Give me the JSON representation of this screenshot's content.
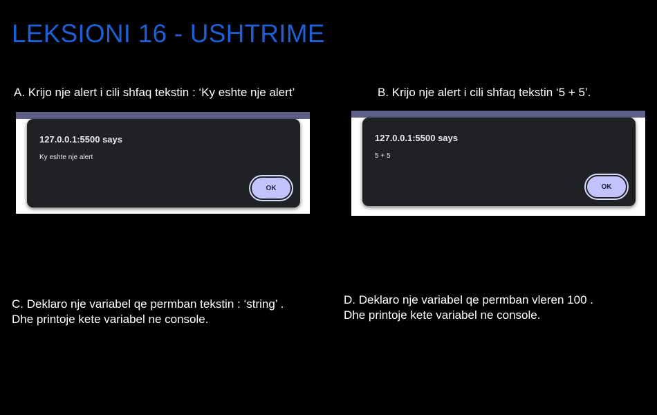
{
  "slide": {
    "title": "LEKSIONI 16 - USHTRIME"
  },
  "tasks": {
    "a": "A. Krijo nje alert i cili shfaq tekstin : ‘Ky eshte nje alert’",
    "b": "B. Krijo nje alert i cili shfaq tekstin ‘5 + 5’.",
    "c": {
      "line1": "C. Deklaro nje variabel qe permban tekstin : ‘string’ .",
      "line2": "Dhe printoje kete variabel ne console."
    },
    "d": {
      "line1": "D. Deklaro nje variabel qe permban vleren 100 .",
      "line2": "Dhe printoje kete variabel ne console."
    }
  },
  "alerts": [
    {
      "origin": "127.0.0.1:5500 says",
      "message": "Ky eshte nje alert",
      "button_label": "OK"
    },
    {
      "origin": "127.0.0.1:5500 says",
      "message": "5 + 5",
      "button_label": "OK"
    }
  ],
  "colors": {
    "title": "#1f5fd6",
    "background": "#000000",
    "dialog": "#202124",
    "ok_button": "#c2c3ff"
  }
}
